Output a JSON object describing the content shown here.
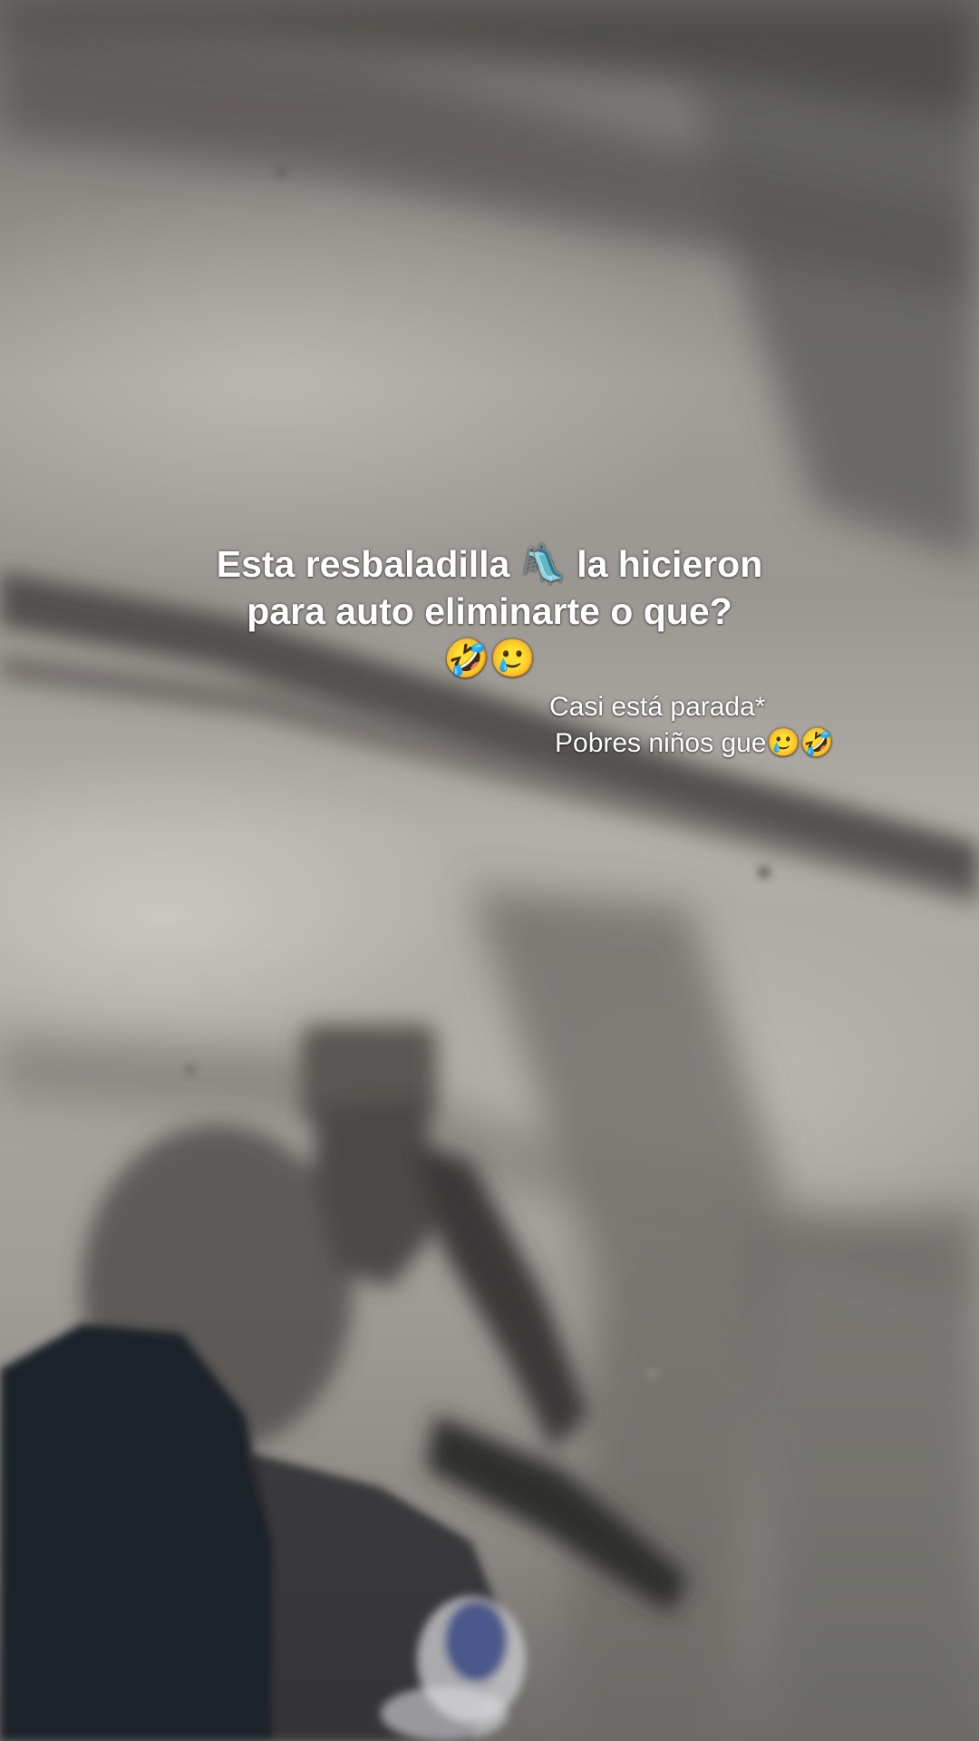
{
  "caption_main": {
    "line1_before": "Esta resbaladilla ",
    "line1_emoji": "🛝",
    "line1_after": " la hicieron",
    "line2": "para auto eliminarte o que?",
    "line3_emojis": "🤣🥲"
  },
  "caption_side": {
    "line1": "Casi está parada*",
    "line2_text": "Pobres niños gue",
    "line2_emojis": "🥲🤣"
  },
  "colors": {
    "concrete_light": "#b2aea8",
    "concrete_dark": "#5e5c59",
    "shadow": "#3c3b39",
    "pants": "#1f232a",
    "shoe_accent": "#3b4a86"
  }
}
